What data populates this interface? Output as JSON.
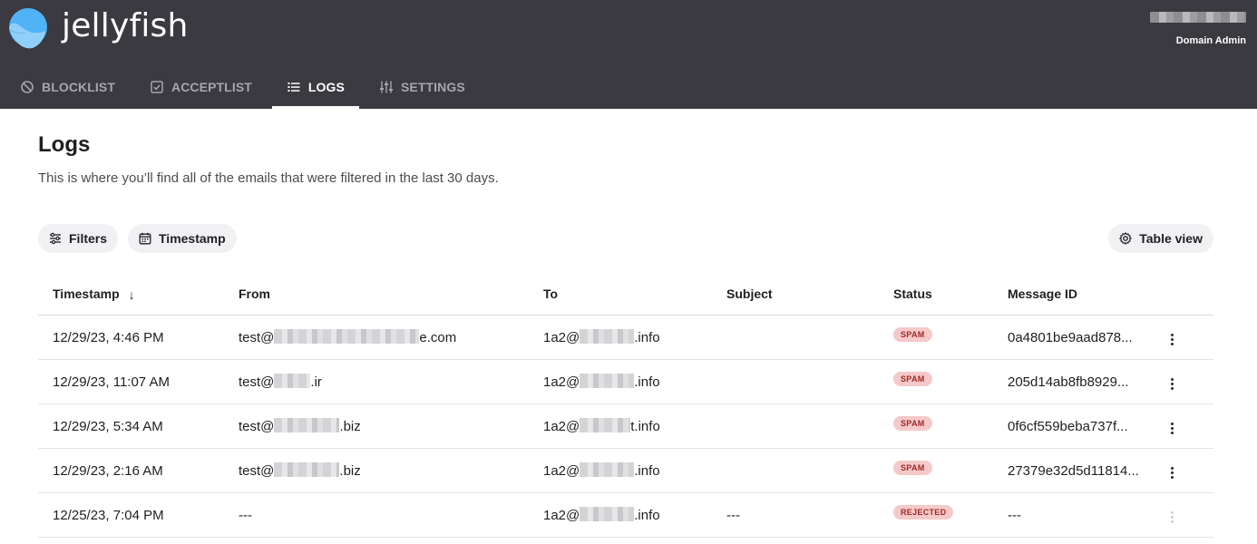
{
  "brand": {
    "name": "jellyfish",
    "accent": "#4fb3f6"
  },
  "user": {
    "role": "Domain Admin"
  },
  "nav": {
    "tabs": [
      {
        "label": "BLOCKLIST",
        "icon": "block-icon",
        "active": false
      },
      {
        "label": "ACCEPTLIST",
        "icon": "checkbox-icon",
        "active": false
      },
      {
        "label": "LOGS",
        "icon": "list-icon",
        "active": true
      },
      {
        "label": "SETTINGS",
        "icon": "sliders-icon",
        "active": false
      }
    ]
  },
  "page": {
    "title": "Logs",
    "description": "This is where you’ll find all of the emails that were filtered in the last 30 days."
  },
  "toolbar": {
    "filters_label": "Filters",
    "timestamp_label": "Timestamp",
    "table_view_label": "Table view"
  },
  "table": {
    "columns": {
      "timestamp": "Timestamp",
      "from": "From",
      "to": "To",
      "subject": "Subject",
      "status": "Status",
      "message_id": "Message ID"
    },
    "sort_indicator": "↓",
    "rows": [
      {
        "timestamp": "12/29/23, 4:46 PM",
        "from_prefix": "test@",
        "from_suffix": "e.com",
        "to_prefix": "1a2@",
        "to_suffix": ".info",
        "subject": "",
        "status": "SPAM",
        "message_id": "0a4801be9aad878..."
      },
      {
        "timestamp": "12/29/23, 11:07 AM",
        "from_prefix": "test@",
        "from_suffix": ".ir",
        "to_prefix": "1a2@",
        "to_suffix": ".info",
        "subject": "",
        "status": "SPAM",
        "message_id": "205d14ab8fb8929..."
      },
      {
        "timestamp": "12/29/23, 5:34 AM",
        "from_prefix": "test@",
        "from_suffix": ".biz",
        "to_prefix": "1a2@",
        "to_suffix": "t.info",
        "subject": "",
        "status": "SPAM",
        "message_id": "0f6cf559beba737f..."
      },
      {
        "timestamp": "12/29/23, 2:16 AM",
        "from_prefix": "test@",
        "from_suffix": ".biz",
        "to_prefix": "1a2@",
        "to_suffix": ".info",
        "subject": "",
        "status": "SPAM",
        "message_id": "27379e32d5d11814..."
      },
      {
        "timestamp": "12/25/23, 7:04 PM",
        "from_prefix": "---",
        "from_suffix": "",
        "to_prefix": "1a2@",
        "to_suffix": ".info",
        "subject": "---",
        "status": "REJECTED",
        "message_id": "---"
      }
    ]
  }
}
